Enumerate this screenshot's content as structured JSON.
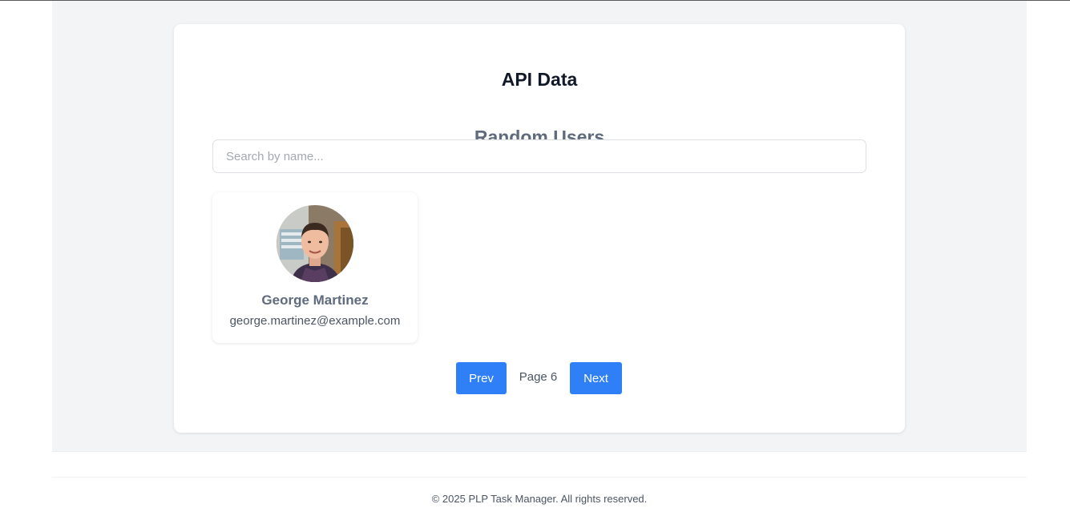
{
  "card": {
    "title": "API Data",
    "section_title": "Random Users",
    "search": {
      "placeholder": "Search by name...",
      "value": ""
    }
  },
  "users": [
    {
      "name": "George Martinez",
      "email": "george.martinez@example.com",
      "avatar_icon": "user-photo"
    }
  ],
  "pagination": {
    "prev_label": "Prev",
    "page_label": "Page 6",
    "next_label": "Next"
  },
  "footer": {
    "text": "© 2025 PLP Task Manager. All rights reserved."
  },
  "colors": {
    "accent": "#2f80f6",
    "page_background": "#f3f4f6",
    "card_background": "#ffffff",
    "title_text": "#111827",
    "muted_heading": "#5f6b7d"
  }
}
